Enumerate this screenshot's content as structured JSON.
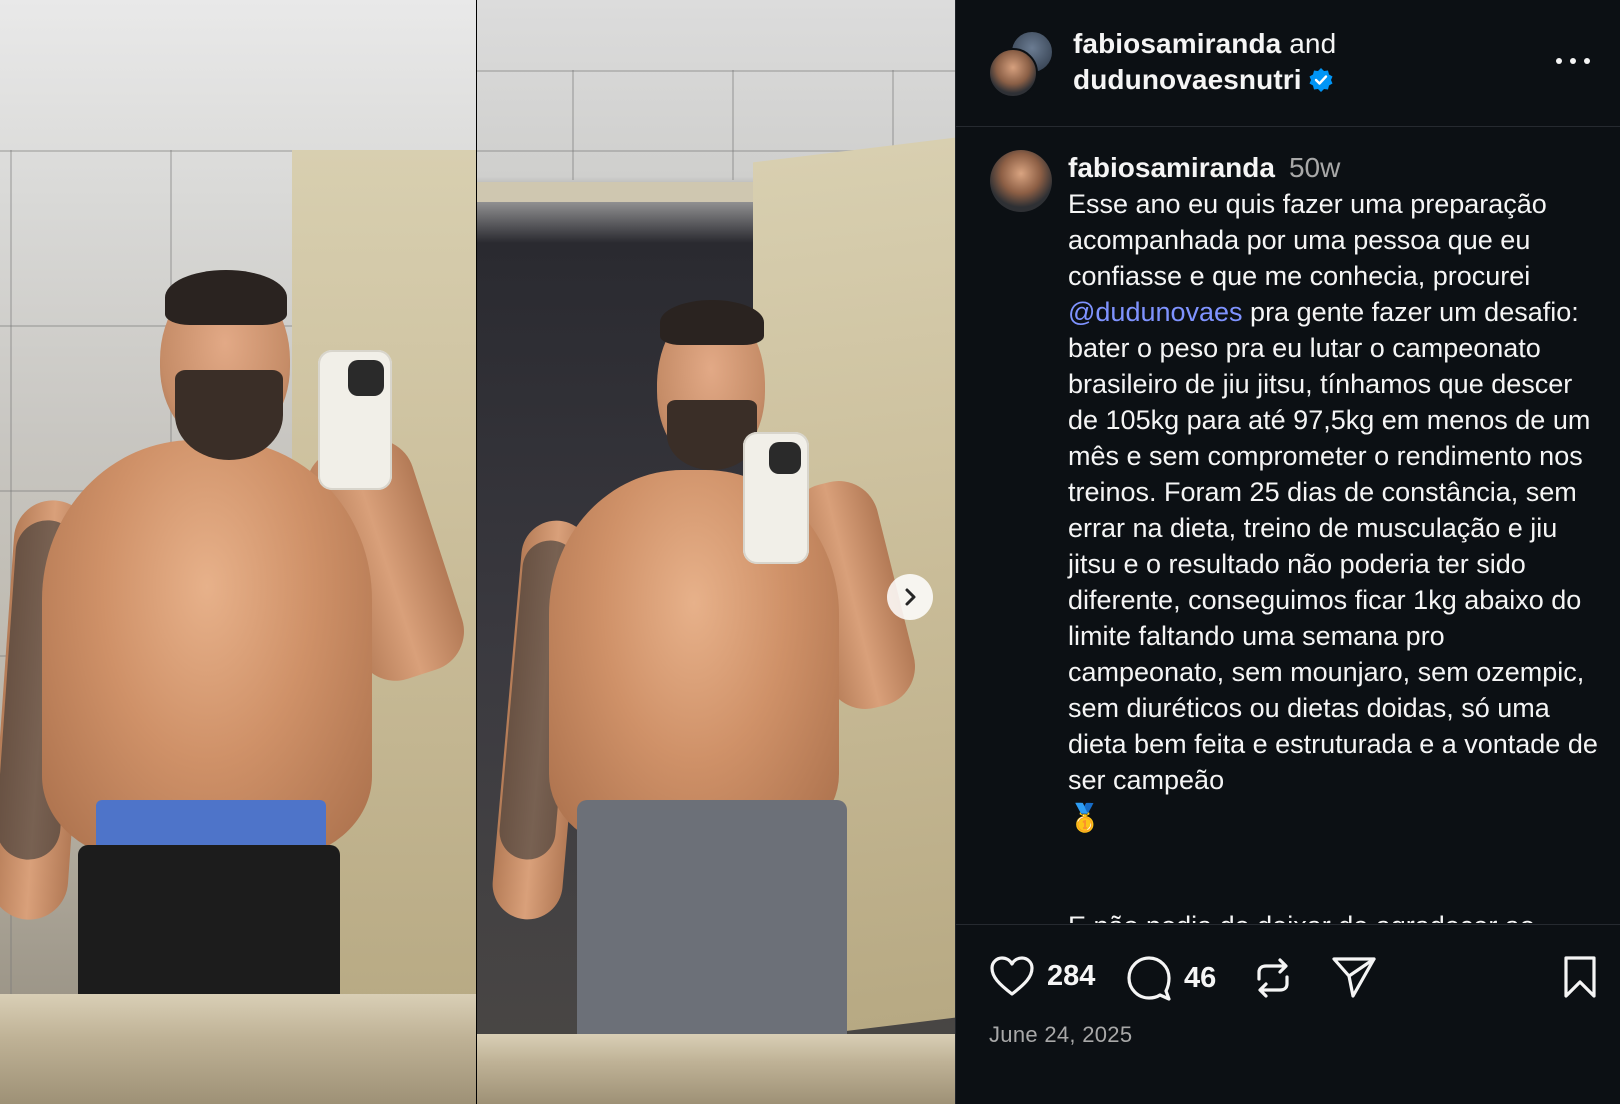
{
  "header": {
    "user1": "fabiosamiranda",
    "conjunction": "and",
    "user2": "dudunovaesnutri"
  },
  "caption": {
    "username": "fabiosamiranda",
    "age": "50w",
    "text_part1": "Esse ano eu quis fazer uma preparação acompanhada por uma pessoa que eu confiasse e que me conhecia, procurei ",
    "mention": "@dudunovaes",
    "text_part2": " pra gente fazer um desafio: bater o peso pra eu lutar o campeonato brasileiro de jiu jitsu, tínhamos que descer de 105kg para até 97,5kg em menos de um mês e sem comprometer o rendimento nos treinos. Foram 25 dias de constância, sem errar na dieta, treino de musculação e jiu jitsu e o resultado não poderia ter sido diferente, conseguimos ficar 1kg abaixo do limite faltando uma semana pro campeonato, sem mounjaro, sem ozempic, sem diuréticos ou dietas doidas, só uma dieta bem feita e estruturada e a vontade de ser campeão",
    "emoji": "🥇",
    "cut_line": "E não podia de deixar de agradecer ao"
  },
  "actions": {
    "likes": "284",
    "comments": "46"
  },
  "date": "June 24, 2025",
  "colors": {
    "background": "#0c1014",
    "mention": "#7f93ff",
    "muted": "#a8a8a8",
    "verified": "#0095f6"
  },
  "icons": [
    "heart-icon",
    "comment-icon",
    "repost-icon",
    "share-icon",
    "bookmark-icon",
    "more-icon",
    "chevron-right-icon",
    "verified-icon"
  ]
}
